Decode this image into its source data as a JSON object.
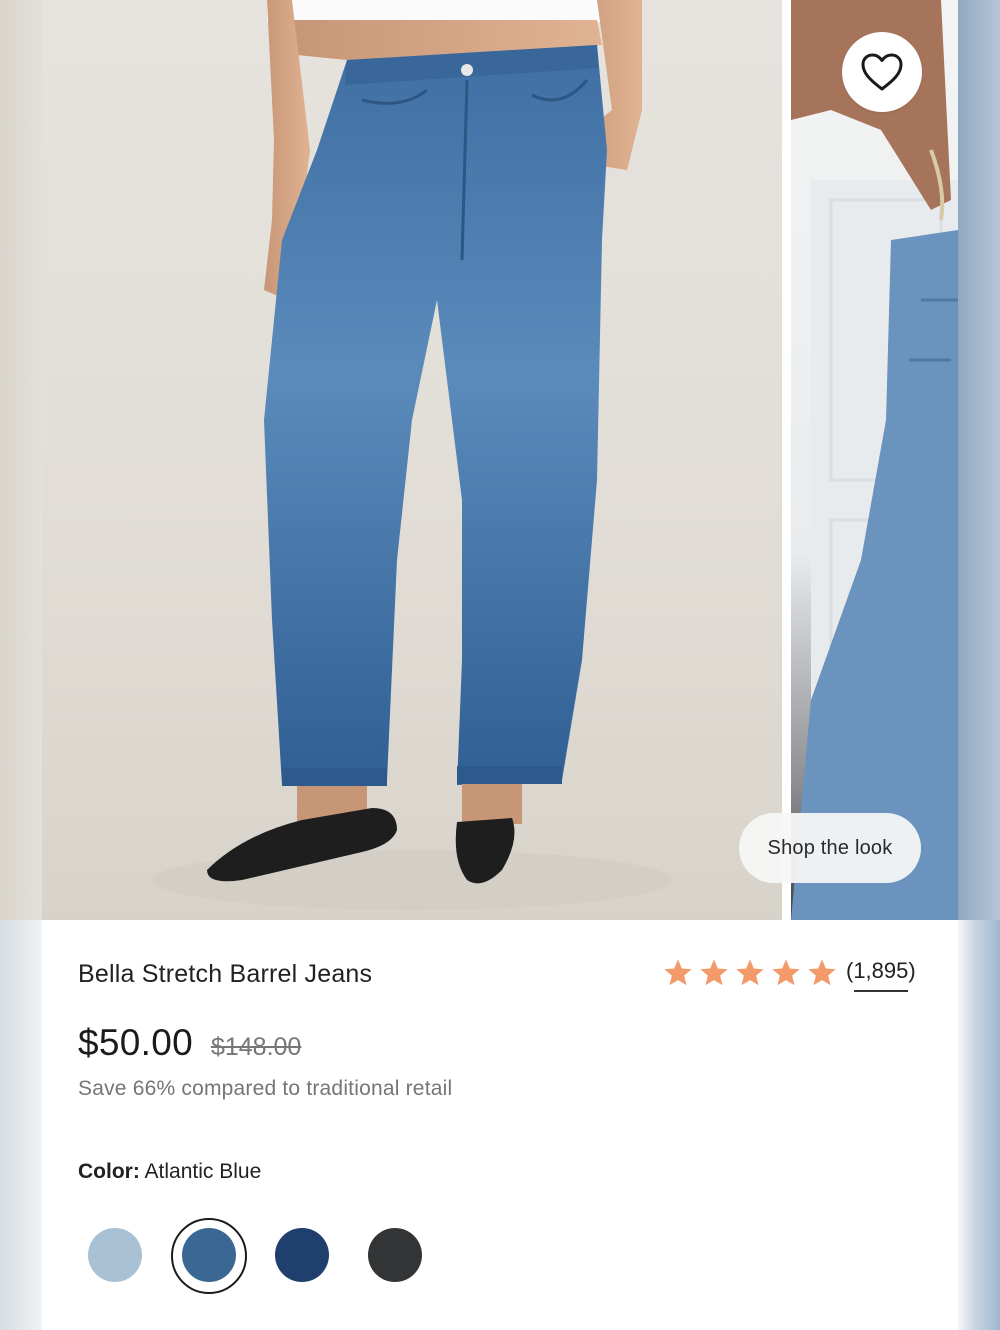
{
  "product": {
    "title": "Bella Stretch Barrel Jeans",
    "rating_count": "(1,895)",
    "rating_stars": 5,
    "price": "$50.00",
    "original_price": "$148.00",
    "savings_text": "Save 66% compared to traditional retail",
    "color_label": "Color:",
    "color_value": "Atlantic Blue"
  },
  "gallery": {
    "shop_the_look_label": "Shop the look",
    "favorite_icon": "heart-outline-icon"
  },
  "swatches": [
    {
      "name": "light-wash",
      "color": "#a9c1d4",
      "selected": false
    },
    {
      "name": "atlantic-blue",
      "color": "#3a6793",
      "selected": true
    },
    {
      "name": "dark-wash",
      "color": "#1f3f6e",
      "selected": false
    },
    {
      "name": "black",
      "color": "#333436",
      "selected": false
    }
  ],
  "colors": {
    "star": "#f39a6a",
    "text": "#222222",
    "muted": "#757575"
  }
}
